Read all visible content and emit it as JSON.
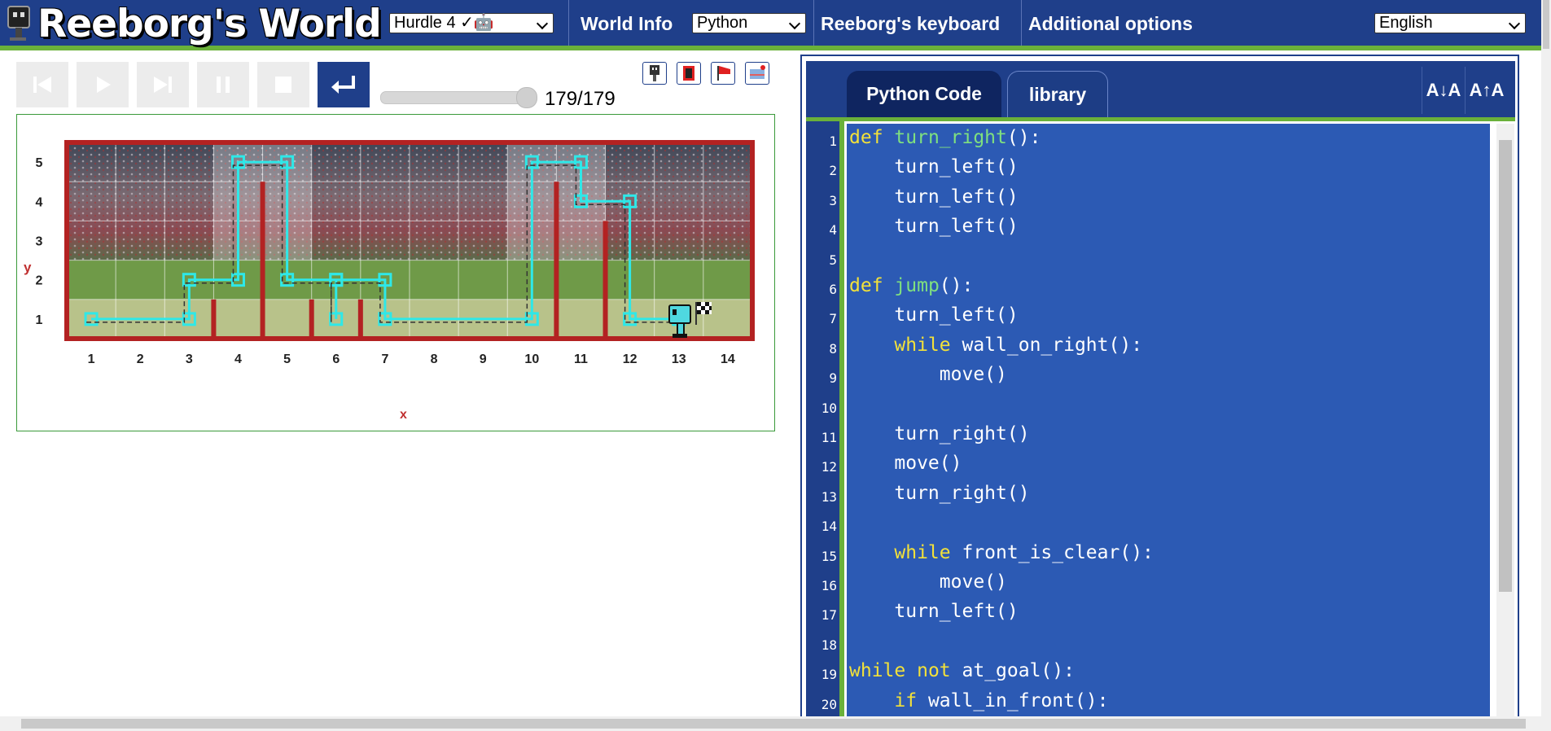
{
  "app": {
    "title": "Reeborg's World"
  },
  "header": {
    "world_select": "Hurdle 4 ✓🤖",
    "world_info": "World Info",
    "language_select": "Python",
    "keyboard": "Reeborg's keyboard",
    "additional": "Additional options",
    "ui_language": "English"
  },
  "controls": {
    "buttons": [
      "reload",
      "play",
      "step",
      "pause",
      "stop",
      "return"
    ],
    "step_current": "179",
    "step_total": "179",
    "step_label": "179/179",
    "slider_value": 1.0
  },
  "world_icons": [
    "robot-details-icon",
    "world-editor-icon",
    "goal-flag-icon",
    "world-memory-icon"
  ],
  "world": {
    "x_axis_label": "x",
    "y_axis_label": "y",
    "x_ticks": [
      "1",
      "2",
      "3",
      "4",
      "5",
      "6",
      "7",
      "8",
      "9",
      "10",
      "11",
      "12",
      "13",
      "14"
    ],
    "y_ticks": [
      "1",
      "2",
      "3",
      "4",
      "5"
    ],
    "walls_east_of_x": [
      {
        "x": 3,
        "height": 1
      },
      {
        "x": 4,
        "height": 4
      },
      {
        "x": 5,
        "height": 1
      },
      {
        "x": 6,
        "height": 1
      },
      {
        "x": 10,
        "height": 4
      },
      {
        "x": 11,
        "height": 3
      }
    ],
    "robot": {
      "x": 13,
      "y": 1
    },
    "goal": {
      "x": 13,
      "y": 1
    },
    "colors": {
      "wall": "#b32222",
      "trace": "#2ee8e8",
      "frame": "#3a9a3a"
    }
  },
  "editor": {
    "tabs": [
      "Python Code",
      "library"
    ],
    "active_tab": "Python Code",
    "font_buttons": [
      "A↓A",
      "A↑A"
    ],
    "lines": [
      [
        [
          "kw",
          "def"
        ],
        [
          "t",
          " "
        ],
        [
          "fn",
          "turn_right"
        ],
        [
          "t",
          "():"
        ]
      ],
      [
        [
          "t",
          "    turn_left()"
        ]
      ],
      [
        [
          "t",
          "    turn_left()"
        ]
      ],
      [
        [
          "t",
          "    turn_left()"
        ]
      ],
      [
        [
          "t",
          ""
        ]
      ],
      [
        [
          "kw",
          "def"
        ],
        [
          "t",
          " "
        ],
        [
          "fn",
          "jump"
        ],
        [
          "t",
          "():"
        ]
      ],
      [
        [
          "t",
          "    turn_left()"
        ]
      ],
      [
        [
          "t",
          "    "
        ],
        [
          "kw",
          "while"
        ],
        [
          "t",
          " wall_on_right():"
        ]
      ],
      [
        [
          "t",
          "        move()"
        ]
      ],
      [
        [
          "t",
          ""
        ]
      ],
      [
        [
          "t",
          "    turn_right()"
        ]
      ],
      [
        [
          "t",
          "    move()"
        ]
      ],
      [
        [
          "t",
          "    turn_right()"
        ]
      ],
      [
        [
          "t",
          ""
        ]
      ],
      [
        [
          "t",
          "    "
        ],
        [
          "kw",
          "while"
        ],
        [
          "t",
          " front_is_clear():"
        ]
      ],
      [
        [
          "t",
          "        move()"
        ]
      ],
      [
        [
          "t",
          "    turn_left()"
        ]
      ],
      [
        [
          "t",
          ""
        ]
      ],
      [
        [
          "kw",
          "while"
        ],
        [
          "t",
          " "
        ],
        [
          "kw",
          "not"
        ],
        [
          "t",
          " at_goal():"
        ]
      ],
      [
        [
          "t",
          "    "
        ],
        [
          "kw",
          "if"
        ],
        [
          "t",
          " wall_in_front():"
        ]
      ]
    ]
  }
}
